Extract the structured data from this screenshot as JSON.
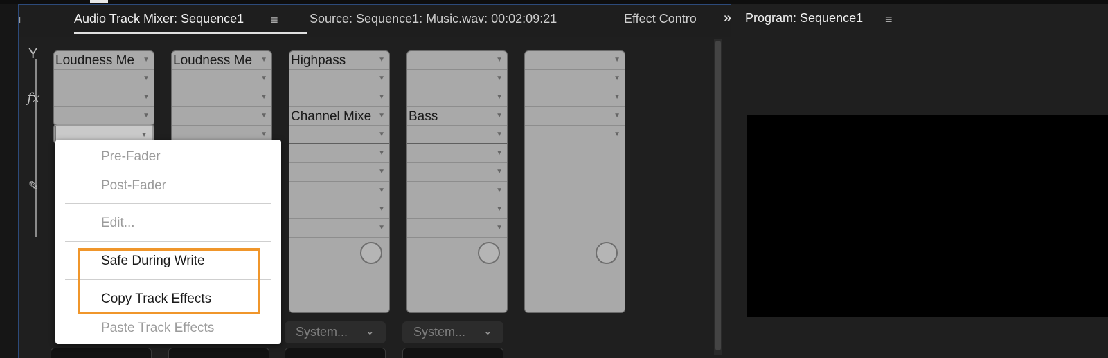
{
  "header": {
    "left_glyph": "l",
    "tabs": [
      {
        "label": "Audio Track Mixer: Sequence1"
      },
      {
        "label": "Source: Sequence1: Music.wav: 00:02:09:21"
      },
      {
        "label": "Effect Contro"
      }
    ],
    "menu_icon": "≡",
    "overflow_icon": "»"
  },
  "program": {
    "title": "Program: Sequence1",
    "menu_icon": "≡"
  },
  "lane_icons": {
    "top": "Y",
    "fx": "fx",
    "send": "send-icon"
  },
  "strips": [
    {
      "slots": [
        "Loudness Me",
        "",
        "",
        "",
        ""
      ]
    },
    {
      "slots": [
        "Loudness Me",
        "",
        "",
        "",
        ""
      ]
    },
    {
      "slots": [
        "Highpass",
        "",
        "",
        "Channel Mixe",
        "",
        "",
        "",
        "",
        "",
        ""
      ],
      "send": "System..."
    },
    {
      "slots": [
        "",
        "",
        "",
        "Bass",
        "",
        "",
        "",
        "",
        "",
        ""
      ],
      "send": "System..."
    },
    {
      "slots": [
        "",
        "",
        "",
        "",
        ""
      ]
    }
  ],
  "context_menu": {
    "items": [
      {
        "label": "Pre-Fader",
        "enabled": false
      },
      {
        "label": "Post-Fader",
        "enabled": false
      },
      {
        "label": "Edit...",
        "enabled": false
      },
      {
        "label": "Safe During Write",
        "enabled": true
      },
      {
        "label": "Copy Track Effects",
        "enabled": true
      },
      {
        "label": "Paste Track Effects",
        "enabled": false
      }
    ]
  },
  "colors": {
    "highlight": "#f0962b",
    "panel_border": "#2c4a7a"
  }
}
